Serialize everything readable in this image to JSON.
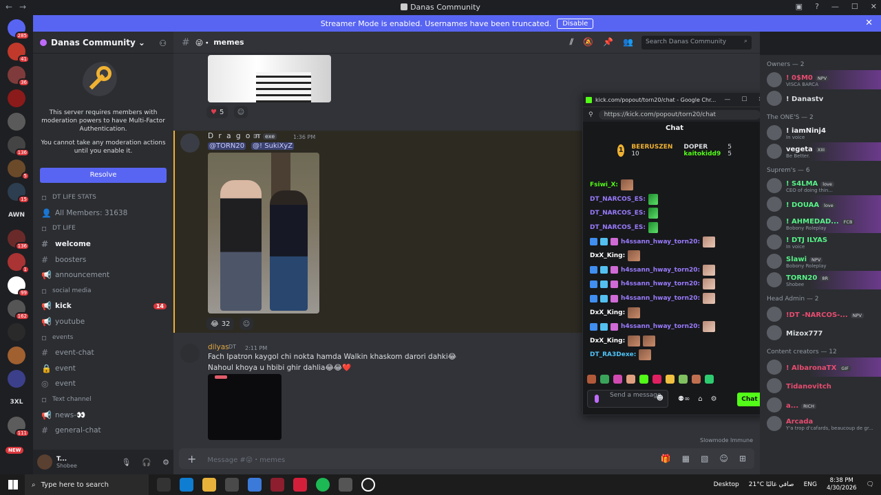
{
  "window": {
    "title": "Danas Community"
  },
  "banner": {
    "text": "Streamer Mode is enabled. Usernames have been truncated.",
    "button": "Disable"
  },
  "servers": {
    "badges": [
      "285",
      "41",
      "36",
      "136",
      "5",
      "15",
      "136",
      "1",
      "99",
      "162",
      "111"
    ],
    "awn": "AWN",
    "threexl": "3XL",
    "new": "NEW"
  },
  "server": {
    "name": "Danas Community",
    "mfa_line1": "This server requires members with moderation powers to have Multi-Factor Authentication.",
    "mfa_line2": "You cannot take any moderation actions until you enable it.",
    "resolve": "Resolve"
  },
  "channels": [
    {
      "label": "DT LIFE STATS",
      "type": "cat"
    },
    {
      "label": "All Members: 31638",
      "type": "stat"
    },
    {
      "label": "DT LIFE",
      "type": "cat"
    },
    {
      "label": "welcome",
      "type": "text",
      "active": true
    },
    {
      "label": "boosters",
      "type": "text"
    },
    {
      "label": "announcement",
      "type": "announce"
    },
    {
      "label": "social media",
      "type": "cat"
    },
    {
      "label": "kick",
      "type": "announce",
      "count": "14",
      "active": true
    },
    {
      "label": "youtube",
      "type": "announce"
    },
    {
      "label": "events",
      "type": "cat"
    },
    {
      "label": "event-chat",
      "type": "text"
    },
    {
      "label": "event",
      "type": "locked"
    },
    {
      "label": "event",
      "type": "stage"
    },
    {
      "label": "Text channel",
      "type": "cat"
    },
    {
      "label": "news-👀",
      "type": "announce"
    },
    {
      "label": "general-chat",
      "type": "text"
    }
  ],
  "user": {
    "name": "T...",
    "status": "Shobee"
  },
  "channel": {
    "name": "memes",
    "search_placeholder": "Search Danas Community"
  },
  "messages": {
    "react1": "5",
    "dragon": {
      "name": "D r a g o n",
      "tag": "DT",
      "badge": "exe",
      "time": "1:36 PM",
      "mention1": "@TORN20",
      "mention2": "@! SukiXyZ",
      "react": "32"
    },
    "dilyas": {
      "name": "dilyas",
      "tag": "DT",
      "time": "2:11 PM",
      "line1": "Fach Ipatron kaygol chi nokta hamda Walkin khaskom darori dahki😂",
      "line2": "Nahoul khoya u hbibi ghir dahlia😂😂❤️"
    },
    "slowmode": "Slowmode Immune",
    "composer_placeholder": "Message #😜・memes"
  },
  "kick": {
    "window_title": "kick.com/popout/torn20/chat - Google Chr...",
    "url": "https://kick.com/popout/torn20/chat",
    "title": "Chat",
    "leader1": {
      "rank": "1",
      "name": "BEERUSZEN",
      "count": "10"
    },
    "leader2": {
      "name": "DOPER",
      "count": "5"
    },
    "leader3": {
      "name": "kaitokidd9",
      "count": "5"
    },
    "lines": [
      {
        "user": "Fsiwi_X:",
        "color": "#53fc18",
        "emotes": 1
      },
      {
        "user": "DT_NARCOS_ES:",
        "color": "#9a7bff",
        "emotes": 1,
        "green": true
      },
      {
        "user": "DT_NARCOS_ES:",
        "color": "#9a7bff",
        "emotes": 1,
        "green": true
      },
      {
        "user": "DT_NARCOS_ES:",
        "color": "#9a7bff",
        "emotes": 1,
        "green": true
      },
      {
        "user": "h4ssann_hway_torn20:",
        "color": "#9a7bff",
        "emotes": 1,
        "badges": true
      },
      {
        "user": "DxX_King:",
        "color": "#ffffff",
        "emotes": 1
      },
      {
        "user": "h4ssann_hway_torn20:",
        "color": "#9a7bff",
        "emotes": 1,
        "badges": true
      },
      {
        "user": "h4ssann_hway_torn20:",
        "color": "#9a7bff",
        "emotes": 1,
        "badges": true
      },
      {
        "user": "h4ssann_hway_torn20:",
        "color": "#9a7bff",
        "emotes": 1,
        "badges": true
      },
      {
        "user": "DxX_King:",
        "color": "#ffffff",
        "emotes": 1
      },
      {
        "user": "h4ssann_hway_torn20:",
        "color": "#9a7bff",
        "emotes": 1,
        "badges": true
      },
      {
        "user": "DxX_King:",
        "color": "#ffffff",
        "emotes": 2
      },
      {
        "user": "DT_RA3Dexe:",
        "color": "#4fc3f7",
        "emotes": 1
      }
    ],
    "send_placeholder": "Send a message",
    "chat_button": "Chat"
  },
  "members": [
    {
      "group": "Owners — 2",
      "items": [
        {
          "name": "! 0$M0",
          "tag": "NPV",
          "status": "VISCA BARCA",
          "color": "#e74c6f",
          "banner": true
        },
        {
          "name": "! Danastv",
          "status": "",
          "color": "#dbdee1"
        }
      ]
    },
    {
      "group": "The ONE'S — 2",
      "items": [
        {
          "name": "! iamNinj4",
          "status": "In voice",
          "color": "#f2f3f5"
        },
        {
          "name": "vegeta",
          "tag": "XIII",
          "status": "Be Better.",
          "color": "#f2f3f5",
          "banner": true
        }
      ]
    },
    {
      "group": "Suprem's — 6",
      "items": [
        {
          "name": "! S4LMA",
          "tag": "love",
          "status": "CEO of doing thin...",
          "color": "#57f287"
        },
        {
          "name": "! DOUAA",
          "tag": "love",
          "status": "",
          "color": "#57f287",
          "banner": true
        },
        {
          "name": "! AHMEDAD...",
          "tag": "FCB",
          "status": "Bobony Roleplay",
          "color": "#57f287",
          "banner": true
        },
        {
          "name": "! DTJ ILYAS",
          "status": "In voice",
          "color": "#57f287"
        },
        {
          "name": "Slawi",
          "tag": "NPV",
          "status": "Bobony Roleplay",
          "color": "#57f287"
        },
        {
          "name": "TORN20",
          "tag": "8R",
          "status": "Shobee",
          "color": "#57f287",
          "banner": true
        }
      ]
    },
    {
      "group": "Head Admin — 2",
      "items": [
        {
          "name": "!DT -NARCOS-...",
          "tag": "NPV",
          "status": "",
          "color": "#e74c6f"
        },
        {
          "name": "Mizox777",
          "status": "",
          "color": "#dbdee1"
        }
      ]
    },
    {
      "group": "Content creators — 12",
      "items": [
        {
          "name": "! AlbaronaTX",
          "tag": "GIF",
          "status": "",
          "color": "#e74c6f",
          "banner": true
        },
        {
          "name": "Tidanovitch",
          "status": "",
          "color": "#e74c6f"
        },
        {
          "name": "a...",
          "tag": "RICH",
          "status": "",
          "color": "#e74c6f"
        },
        {
          "name": "Arcada",
          "status": "Y'a trop d'cafards, beaucoup de gr...",
          "color": "#e74c6f"
        }
      ]
    }
  ],
  "taskbar": {
    "search": "Type here to search",
    "desktop": "Desktop",
    "weather": "21°C  صافي غالبًا",
    "lang": "ENG",
    "time": "8:38 PM",
    "date": "4/30/2026"
  }
}
